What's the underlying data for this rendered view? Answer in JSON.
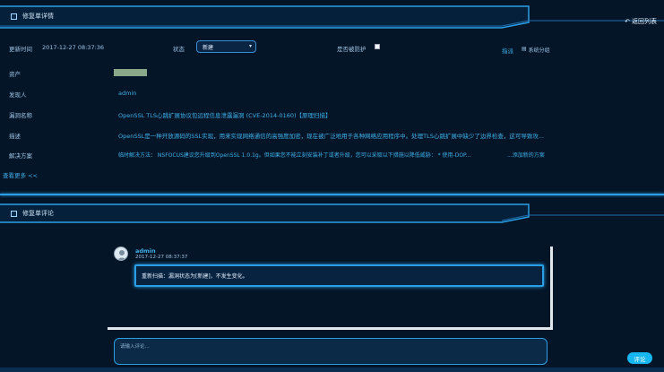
{
  "header1": {
    "title": "修复单详情",
    "back_label": "返回列表"
  },
  "fields": {
    "update_time_label": "更新时间",
    "update_time_value": "2017-12-27 08:37:36",
    "status_label": "状态",
    "status_value": "新建",
    "whitelisted_label": "是否被防护",
    "fix_label": "指派",
    "system_tag_label": "系统分组",
    "asset_label": "资产",
    "finder_label": "发现人",
    "finder_value": "admin",
    "vuln_name_label": "漏洞名称",
    "vuln_name_value": "OpenSSL TLS心跳扩展协议包远程信息泄露漏洞 (CVE-2014-0160)【原理扫描】",
    "desc_label": "描述",
    "desc_value": "OpenSSL是一种开放源码的SSL实现，用来实现网络通信的高强度加密，现在被广泛地用于各种网络应用程序中。处理TLS心跳扩展中缺少了边界检查，这可导致攻...",
    "solution_label": "解决方案",
    "solution_value": "临时解决方法： NSFOCUS建议您升级到OpenSSL 1.0.1g。但如果您不能立刻安装补丁或者升级，您可以采取以下措施以降低威胁： * 使用-DOP...",
    "solution_more": "...添加新的方案",
    "show_more": "查看更多 <<"
  },
  "header2": {
    "title": "修复单评论"
  },
  "comment": {
    "user": "admin",
    "time": "2017-12-27 08:37:37",
    "text": "重新扫描：漏洞状态为[新建]，不发生变化。"
  },
  "input": {
    "placeholder": "请输入评论..."
  },
  "submit_label": "评论",
  "colors": {
    "background": "#041528",
    "accent": "#2b9fe6",
    "link": "#3fb0e8",
    "button": "#16b6f0"
  }
}
